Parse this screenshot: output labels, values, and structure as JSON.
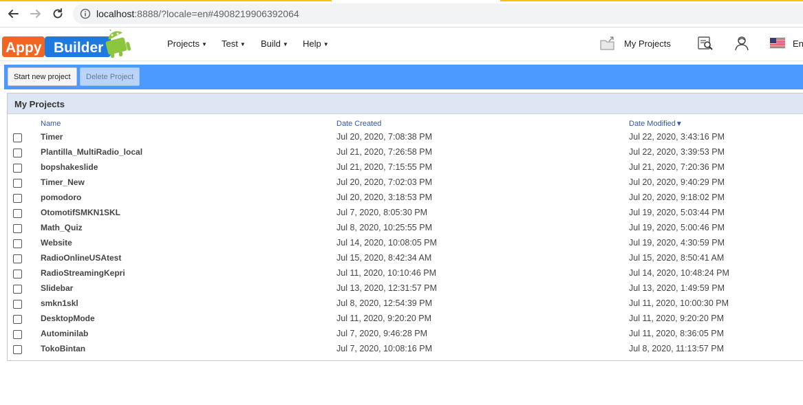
{
  "browser": {
    "url_host": "localhost",
    "url_rest": ":8888/?locale=en#4908219906392064"
  },
  "header": {
    "logo_text_left": "Appy",
    "logo_text_right": "Builder",
    "menus": [
      {
        "label": "Projects"
      },
      {
        "label": "Test"
      },
      {
        "label": "Build"
      },
      {
        "label": "Help"
      }
    ],
    "my_projects_label": "My Projects",
    "language_label": "En"
  },
  "toolbar": {
    "start_new_label": "Start new project",
    "delete_label": "Delete Project"
  },
  "panel": {
    "title": "My Projects",
    "columns": {
      "name": "Name",
      "created": "Date Created",
      "modified": "Date Modified"
    },
    "sort_indicator": "▼",
    "rows": [
      {
        "name": "Timer",
        "created": "Jul 20, 2020, 7:08:38 PM",
        "modified": "Jul 22, 2020, 3:43:16 PM"
      },
      {
        "name": "Plantilla_MultiRadio_local",
        "created": "Jul 21, 2020, 7:26:58 PM",
        "modified": "Jul 22, 2020, 3:39:53 PM"
      },
      {
        "name": "bopshakeslide",
        "created": "Jul 21, 2020, 7:15:55 PM",
        "modified": "Jul 21, 2020, 7:20:36 PM"
      },
      {
        "name": "Timer_New",
        "created": "Jul 20, 2020, 7:02:03 PM",
        "modified": "Jul 20, 2020, 9:40:29 PM"
      },
      {
        "name": "pomodoro",
        "created": "Jul 20, 2020, 3:18:53 PM",
        "modified": "Jul 20, 2020, 9:18:02 PM"
      },
      {
        "name": "OtomotifSMKN1SKL",
        "created": "Jul 7, 2020, 8:05:30 PM",
        "modified": "Jul 19, 2020, 5:03:44 PM"
      },
      {
        "name": "Math_Quiz",
        "created": "Jul 8, 2020, 10:25:55 PM",
        "modified": "Jul 19, 2020, 5:00:46 PM"
      },
      {
        "name": "Website",
        "created": "Jul 14, 2020, 10:08:05 PM",
        "modified": "Jul 19, 2020, 4:30:59 PM"
      },
      {
        "name": "RadioOnlineUSAtest",
        "created": "Jul 15, 2020, 8:42:34 AM",
        "modified": "Jul 15, 2020, 8:50:41 AM"
      },
      {
        "name": "RadioStreamingKepri",
        "created": "Jul 11, 2020, 10:10:46 PM",
        "modified": "Jul 14, 2020, 10:48:24 PM"
      },
      {
        "name": "Slidebar",
        "created": "Jul 13, 2020, 12:31:57 PM",
        "modified": "Jul 13, 2020, 1:49:59 PM"
      },
      {
        "name": "smkn1skl",
        "created": "Jul 8, 2020, 12:54:39 PM",
        "modified": "Jul 11, 2020, 10:00:30 PM"
      },
      {
        "name": "DesktopMode",
        "created": "Jul 11, 2020, 9:20:20 PM",
        "modified": "Jul 11, 2020, 9:20:20 PM"
      },
      {
        "name": "Autominilab",
        "created": "Jul 7, 2020, 9:46:28 PM",
        "modified": "Jul 11, 2020, 8:36:05 PM"
      },
      {
        "name": "TokoBintan",
        "created": "Jul 7, 2020, 10:08:16 PM",
        "modified": "Jul 8, 2020, 11:13:57 PM"
      }
    ]
  },
  "colors": {
    "toolbar": "#4c9aff",
    "panel_header": "#dde6f2",
    "column_link": "#2f58a8",
    "logo_orange": "#f26522",
    "logo_blue": "#1f7ae0",
    "android_green": "#8cc63f"
  }
}
